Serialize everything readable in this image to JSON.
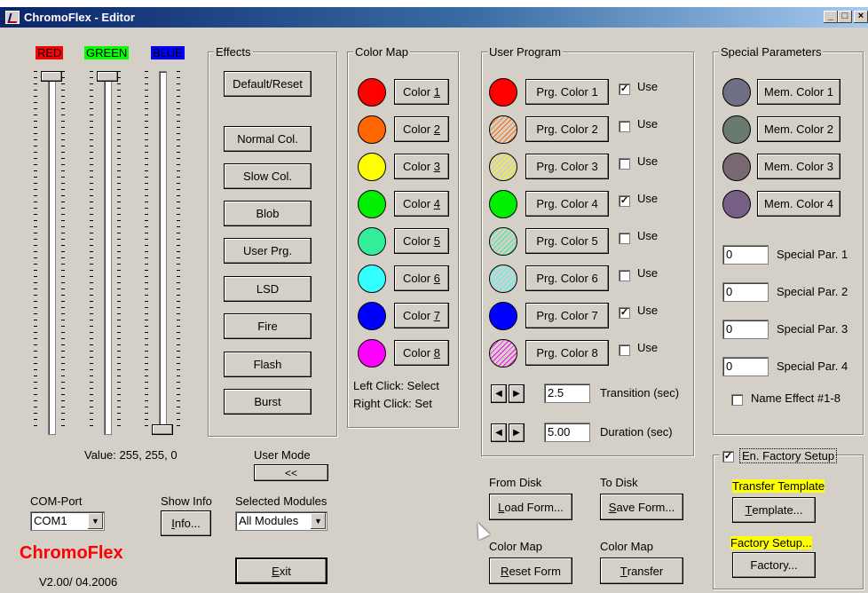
{
  "window": {
    "title": "ChromoFlex - Editor",
    "controls": [
      "_",
      "□",
      "×"
    ]
  },
  "sliders": [
    {
      "label": "RED",
      "color": "#ff0000",
      "textColor": "#000000",
      "level": 1.0
    },
    {
      "label": "GREEN",
      "color": "#00ff00",
      "textColor": "#000000",
      "level": 1.0
    },
    {
      "label": "BLUE",
      "color": "#0000ff",
      "textColor": "#000000",
      "level": 0.0
    }
  ],
  "value_text": "Value: 255, 255, 0",
  "effects": {
    "title": "Effects",
    "buttons": [
      "Default/Reset",
      "Normal Col.",
      "Slow Col.",
      "Blob",
      "User Prg.",
      "LSD",
      "Fire",
      "Flash",
      "Burst"
    ]
  },
  "color_map": {
    "title": "Color Map",
    "items": [
      {
        "label_pre": "Color ",
        "label_key": "1",
        "color": "#ff0000"
      },
      {
        "label_pre": "Color ",
        "label_key": "2",
        "color": "#ff6600"
      },
      {
        "label_pre": "Color ",
        "label_key": "3",
        "color": "#ffff00"
      },
      {
        "label_pre": "Color ",
        "label_key": "4",
        "color": "#00ee00"
      },
      {
        "label_pre": "Color ",
        "label_key": "5",
        "color": "#33ee99"
      },
      {
        "label_pre": "Color ",
        "label_key": "6",
        "color": "#33ffff"
      },
      {
        "label_pre": "Color ",
        "label_key": "7",
        "color": "#0000ff"
      },
      {
        "label_pre": "Color ",
        "label_key": "8",
        "color": "#ff00ff"
      }
    ],
    "hint1": "Left Click: Select",
    "hint2": "Right Click: Set"
  },
  "user_program": {
    "title": "User Program",
    "use_label": "Use",
    "items": [
      {
        "label": "Prg. Color 1",
        "color": "#ff0000",
        "use": true
      },
      {
        "label": "Prg. Color 2",
        "color": "#ff6600",
        "use": false
      },
      {
        "label": "Prg. Color 3",
        "color": "#ffff00",
        "use": false
      },
      {
        "label": "Prg. Color 4",
        "color": "#00ee00",
        "use": true
      },
      {
        "label": "Prg. Color 5",
        "color": "#33ee99",
        "use": false
      },
      {
        "label": "Prg. Color 6",
        "color": "#33ffff",
        "use": false
      },
      {
        "label": "Prg. Color 7",
        "color": "#0000ff",
        "use": true
      },
      {
        "label": "Prg. Color 8",
        "color": "#ff00ff",
        "use": false
      }
    ],
    "transition_value": "2.5",
    "transition_label": "Transition (sec)",
    "duration_value": "5.00",
    "duration_label": "Duration (sec)"
  },
  "special": {
    "title": "Special Parameters",
    "mem": [
      {
        "label": "Mem. Color 1",
        "color": "#6e6e84"
      },
      {
        "label": "Mem. Color 2",
        "color": "#687b6e"
      },
      {
        "label": "Mem. Color 3",
        "color": "#776871"
      },
      {
        "label": "Mem. Color 4",
        "color": "#775f86"
      }
    ],
    "pars": [
      {
        "value": "0",
        "label": "Special Par. 1"
      },
      {
        "value": "0",
        "label": "Special Par. 2"
      },
      {
        "value": "0",
        "label": "Special Par. 3"
      },
      {
        "value": "0",
        "label": "Special Par. 4"
      }
    ],
    "name_effect_label": "Name Effect #1-8",
    "name_effect_checked": false
  },
  "factory": {
    "checkbox_label": "En. Factory Setup",
    "checked": true,
    "transfer_template_label": "Transfer Template",
    "template_button_pre": "",
    "template_button_key": "T",
    "template_button_post": "emplate...",
    "factory_setup_label": "Factory Setup...",
    "factory_button": "Factory..."
  },
  "user_mode": {
    "label": "User Mode",
    "button": "<<"
  },
  "com": {
    "label": "COM-Port",
    "value": "COM1"
  },
  "show_info": {
    "label": "Show Info",
    "btn_key": "I",
    "btn_post": "nfo..."
  },
  "modules": {
    "label": "Selected Modules",
    "value": "All Modules"
  },
  "brand": {
    "name": "ChromoFlex",
    "version": "V2.00/ 04.2006"
  },
  "exit": {
    "key": "E",
    "post": "xit"
  },
  "disk": {
    "from_label": "From Disk",
    "to_label": "To Disk",
    "load_key": "L",
    "load_post": "oad Form...",
    "save_key": "S",
    "save_post": "ave Form...",
    "cm_label1": "Color Map",
    "cm_label2": "Color Map",
    "reset_key": "R",
    "reset_post": "eset Form",
    "transfer_key": "T",
    "transfer_post": "ransfer"
  }
}
